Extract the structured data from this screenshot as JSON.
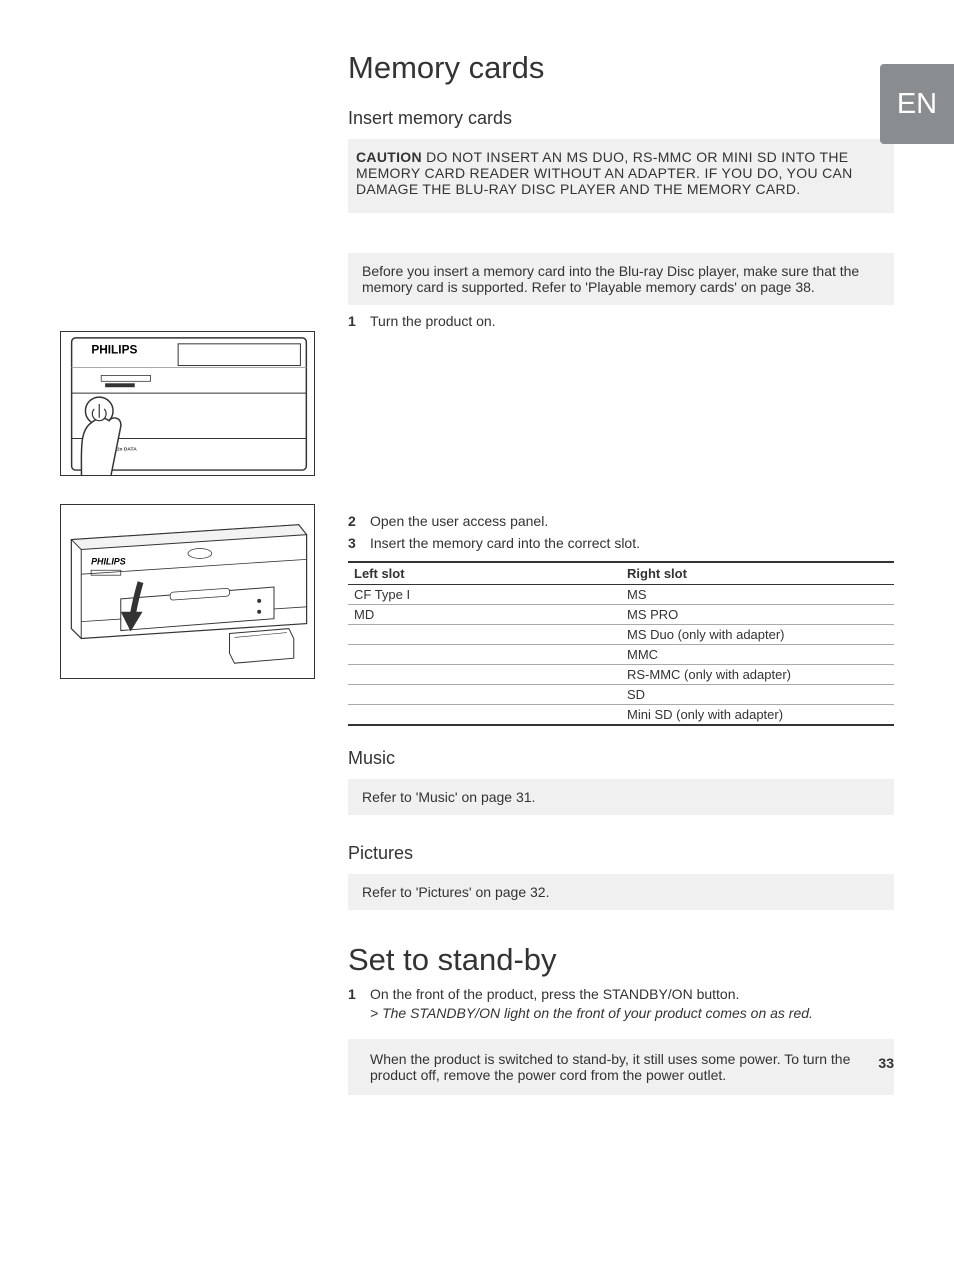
{
  "language_tag": "EN",
  "page_number": "33",
  "heading_memory_cards": "Memory cards",
  "heading_insert": "Insert memory cards",
  "caution_label": "CAUTION",
  "caution_text_rest": " DO NOT INSERT AN MS DUO, RS-MMC OR MINI SD INTO THE MEMORY CARD READER WITHOUT AN ADAPTER. IF YOU DO, YOU CAN DAMAGE THE BLU-RAY DISC PLAYER AND THE MEMORY CARD.",
  "pre_insert_note": "Before you insert a memory card into the Blu-ray Disc player, make sure that the memory card is supported. Refer to 'Playable memory cards' on page 38.",
  "step1_num": "1",
  "step1_txt": "Turn the product on.",
  "step2_num": "2",
  "step2_txt": "Open the user access panel.",
  "step3_num": "3",
  "step3_txt": "Insert the memory card into the correct slot.",
  "table_header_left": "Left slot",
  "table_header_right": "Right slot",
  "table_rows": [
    {
      "left": "CF Type I",
      "right": "MS"
    },
    {
      "left": "MD",
      "right": "MS PRO"
    },
    {
      "left": "",
      "right": "MS Duo (only with adapter)"
    },
    {
      "left": "",
      "right": "MMC"
    },
    {
      "left": "",
      "right": "RS-MMC (only with adapter)"
    },
    {
      "left": "",
      "right": "SD"
    },
    {
      "left": "",
      "right": "Mini SD (only with adapter)"
    }
  ],
  "heading_music": "Music",
  "music_ref": "Refer to 'Music' on page 31.",
  "heading_pictures": "Pictures",
  "pictures_ref": "Refer to 'Pictures' on page 32.",
  "heading_standby": "Set to stand-by",
  "standby_step_num": "1",
  "standby_step_pre": "On the front of the product, press the ",
  "standby_step_bold": "STANDBY/ON",
  "standby_step_post": " button.",
  "standby_result_pre": "The ",
  "standby_result_bold": "STANDBY/ON",
  "standby_result_post": " light on the front of your product comes on as red.",
  "standby_note": "When the product is switched to stand-by, it still uses some power. To turn the product off, remove the power cord from the power outlet.",
  "illus1_brand": "PHILIPS",
  "illus2_brand": "PHILIPS"
}
